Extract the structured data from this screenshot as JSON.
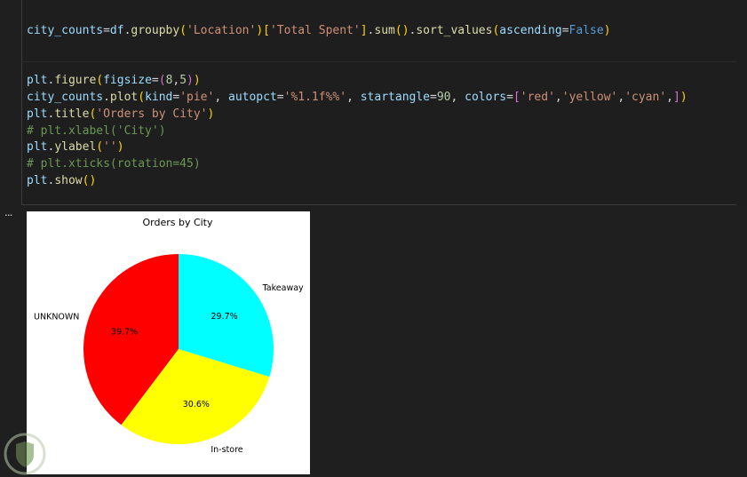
{
  "editor": {
    "code_lines": [
      "city_counts=df.groupby('Location')['Total Spent'].sum().sort_values(ascending=False)",
      "",
      "",
      "plt.figure(figsize=(8,5))",
      "city_counts.plot(kind='pie', autopct='%1.1f%%', startangle=90, colors=['red','yellow','cyan',])",
      "plt.title('Orders by City')",
      "# plt.xlabel('City')",
      "plt.ylabel('')",
      "# plt.xticks(rotation=45)",
      "plt.show()"
    ],
    "output_ellipsis": "..."
  },
  "chart_data": {
    "type": "pie",
    "title": "Orders by City",
    "start_angle": 90,
    "categories": [
      "UNKNOWN",
      "In-store",
      "Takeaway"
    ],
    "values": [
      39.7,
      30.6,
      29.7
    ],
    "labels_pct": [
      "39.7%",
      "30.6%",
      "29.7%"
    ],
    "colors": [
      "#ff0000",
      "#ffff00",
      "#00ffff"
    ],
    "xlabel": "",
    "ylabel": ""
  }
}
